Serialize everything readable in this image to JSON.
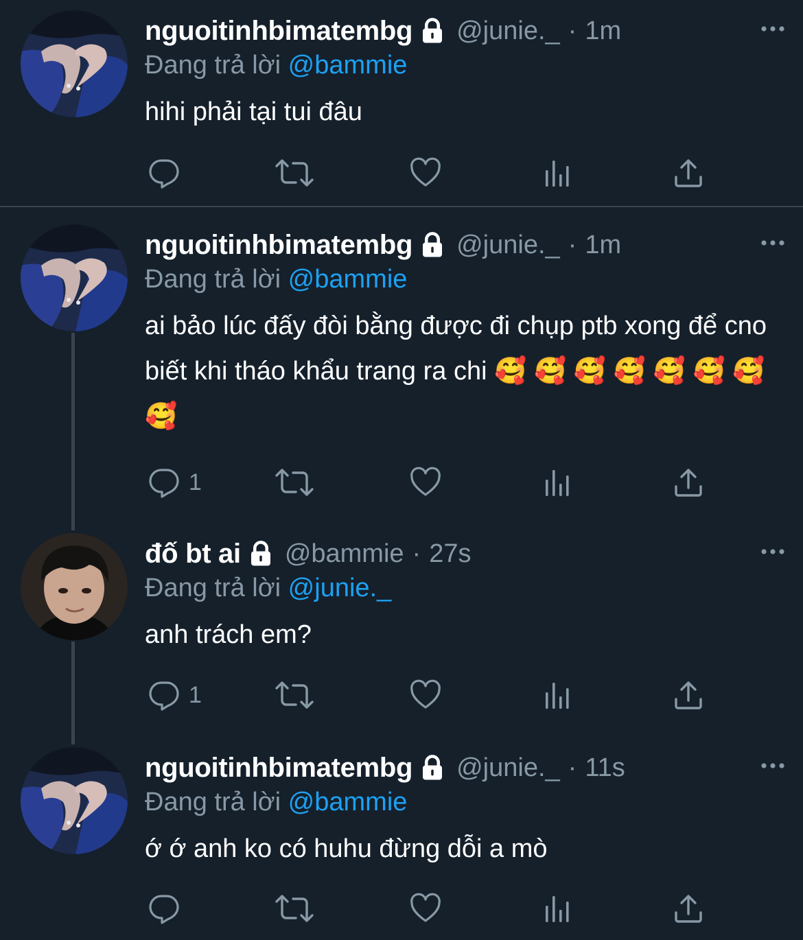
{
  "tweets": [
    {
      "name": "nguoitinhbimatembg",
      "handle": "@junie._",
      "dot": "·",
      "time": "1m",
      "replying_prefix": "Đang trả lời ",
      "replying_to": "@bammie",
      "text": "hihi phải tại tui đâu",
      "reply_count": "",
      "avatar_icon": "heart-hands-avatar"
    },
    {
      "name": "nguoitinhbimatembg",
      "handle": "@junie._",
      "dot": "·",
      "time": "1m",
      "replying_prefix": "Đang trả lời ",
      "replying_to": "@bammie",
      "text": "ai bảo lúc đấy đòi bằng được đi chụp ptb xong để cno biết khi tháo khẩu trang ra chi 🥰 🥰 🥰 🥰 🥰 🥰 🥰 🥰",
      "reply_count": "1",
      "avatar_icon": "heart-hands-avatar"
    },
    {
      "name": "đố bt ai",
      "handle": "@bammie",
      "dot": "·",
      "time": "27s",
      "replying_prefix": "Đang trả lời ",
      "replying_to": "@junie._",
      "text": "anh trách em?",
      "reply_count": "1",
      "avatar_icon": "person-avatar"
    },
    {
      "name": "nguoitinhbimatembg",
      "handle": "@junie._",
      "dot": "·",
      "time": "11s",
      "replying_prefix": "Đang trả lời ",
      "replying_to": "@bammie",
      "text": "ớ ớ anh ko có huhu đừng dỗi a mò",
      "reply_count": "",
      "avatar_icon": "heart-hands-avatar"
    }
  ],
  "icons": {
    "lock": "lock-icon",
    "more": "more-icon",
    "reply": "reply-icon",
    "retweet": "retweet-icon",
    "like": "like-icon",
    "analytics": "analytics-icon",
    "share": "share-icon"
  },
  "colors": {
    "background": "#15202b",
    "secondary_text": "#8899a6",
    "mention": "#1da1f2",
    "divider": "#38444d"
  }
}
